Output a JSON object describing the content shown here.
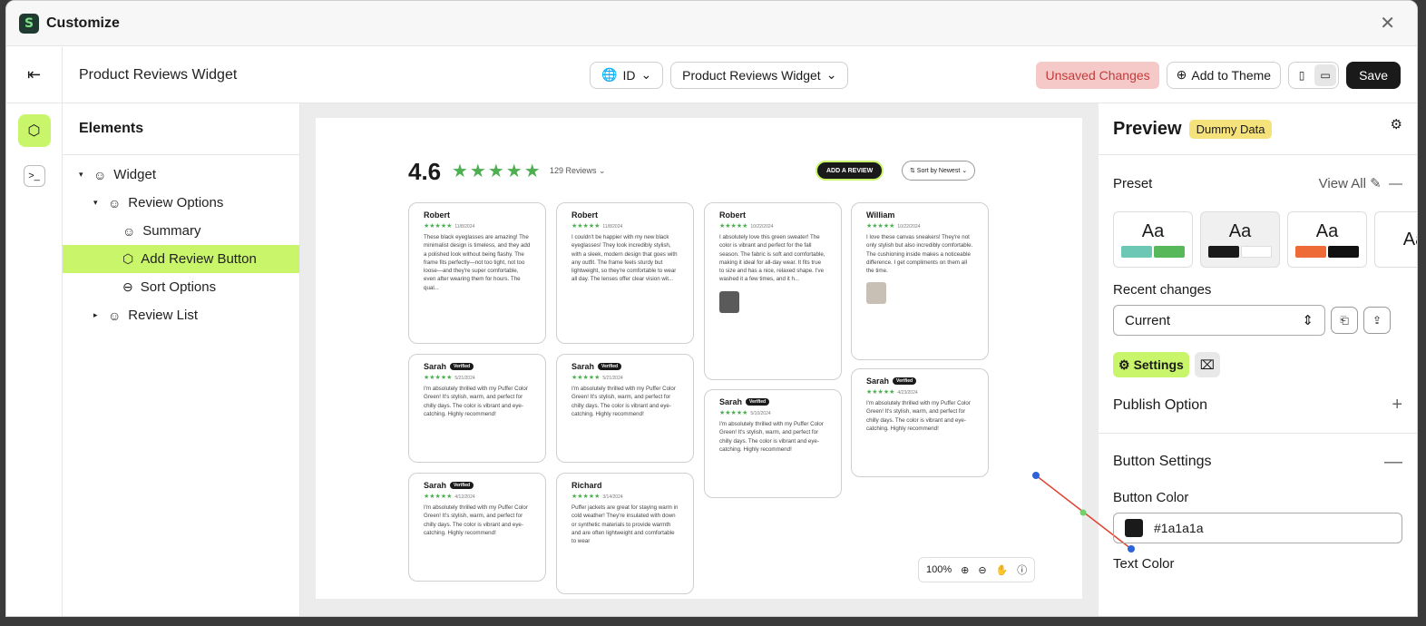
{
  "window": {
    "title": "Customize"
  },
  "toolbar": {
    "doc_title": "Product Reviews Widget",
    "lang": "ID",
    "widget_select": "Product Reviews Widget",
    "unsaved": "Unsaved Changes",
    "add_to_theme": "Add to Theme",
    "save": "Save"
  },
  "elements": {
    "heading": "Elements",
    "tree": [
      "Widget",
      "Review Options",
      "Summary",
      "Add Review Button",
      "Sort Options",
      "Review List"
    ]
  },
  "canvas": {
    "rating": "4.6",
    "review_count": "129 Reviews ⌄",
    "add_review": "ADD A REVIEW",
    "sort": "⇅  Sort by Newest ⌄",
    "zoom": "100%",
    "verified": "Verified",
    "cards": [
      {
        "name": "Robert",
        "date": "11/8/2024",
        "text": "These black eyeglasses are amazing! The minimalist design is timeless, and they add a polished look without being flashy. The frame fits perfectly—not too tight, not too loose—and they're super comfortable, even after wearing them for hours. The qual..."
      },
      {
        "name": "Robert",
        "date": "11/8/2024",
        "text": "I couldn't be happier with my new black eyeglasses! They look incredibly stylish, with a sleek, modern design that goes with any outfit. The frame feels sturdy but lightweight, so they're comfortable to wear all day. The lenses offer clear vision wit..."
      },
      {
        "name": "Robert",
        "date": "10/22/2024",
        "text": "I absolutely love this green sweater! The color is vibrant and perfect for the fall season. The fabric is soft and comfortable, making it ideal for all-day wear. It fits true to size and has a nice, relaxed shape. I've washed it a few times, and it h..."
      },
      {
        "name": "William",
        "date": "10/22/2024",
        "text": "I love these canvas sneakers! They're not only stylish but also incredibly comfortable. The cushioning inside makes a noticeable difference. I get compliments on them all the time."
      },
      {
        "name": "Sarah",
        "date": "5/21/2024",
        "text": "I'm absolutely thrilled with my Puffer Color Green! It's stylish, warm, and perfect for chilly days. The color is vibrant and eye-catching. Highly recommend!"
      },
      {
        "name": "Sarah",
        "date": "5/21/2024",
        "text": "I'm absolutely thrilled with my Puffer Color Green! It's stylish, warm, and perfect for chilly days. The color is vibrant and eye-catching. Highly recommend!"
      },
      {
        "name": "Sarah",
        "date": "5/10/2024",
        "text": "I'm absolutely thrilled with my Puffer Color Green! It's stylish, warm, and perfect for chilly days. The color is vibrant and eye-catching. Highly recommend!"
      },
      {
        "name": "Sarah",
        "date": "4/23/2024",
        "text": "I'm absolutely thrilled with my Puffer Color Green! It's stylish, warm, and perfect for chilly days. The color is vibrant and eye-catching. Highly recommend!"
      },
      {
        "name": "Sarah",
        "date": "4/12/2024",
        "text": "I'm absolutely thrilled with my Puffer Color Green! It's stylish, warm, and perfect for chilly days. The color is vibrant and eye-catching. Highly recommend!"
      },
      {
        "name": "Richard",
        "date": "3/14/2024",
        "text": "Puffer jackets are great for staying warm in cold weather! They're insulated with down or synthetic materials to provide warmth and are often lightweight and comfortable to wear"
      }
    ]
  },
  "right_panel": {
    "title": "Preview",
    "badge": "Dummy Data",
    "preset_label": "Preset",
    "view_all": "View All",
    "preset_sample": "Aa",
    "recent_changes": "Recent changes",
    "recent_value": "Current",
    "settings_tab": "Settings",
    "publish_option": "Publish Option",
    "button_settings": "Button Settings",
    "button_color_label": "Button Color",
    "button_color_value": "#1a1a1a",
    "text_color_label": "Text Color"
  },
  "colors": {
    "accent": "#c9f56a",
    "star": "#4caf50",
    "unsaved_bg": "#f6c9c9"
  }
}
